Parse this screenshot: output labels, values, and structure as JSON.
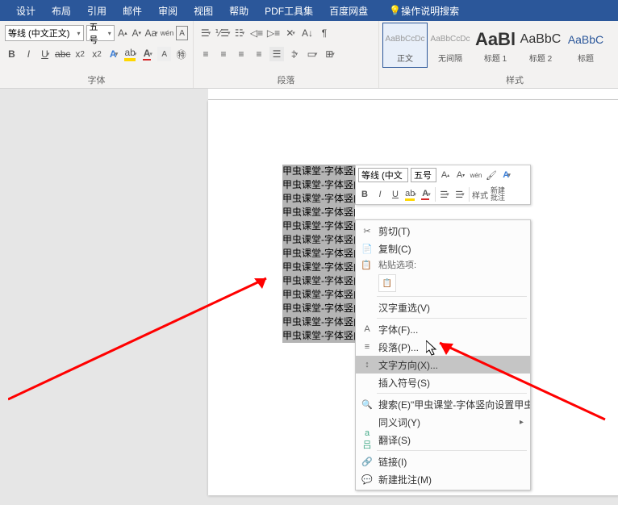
{
  "tabs": [
    "设计",
    "布局",
    "引用",
    "邮件",
    "审阅",
    "视图",
    "帮助",
    "PDF工具集",
    "百度网盘"
  ],
  "tell_me": "操作说明搜索",
  "font_group": {
    "font_name": "等线 (中文正文)",
    "font_size": "五号",
    "label": "字体"
  },
  "para_group": {
    "label": "段落"
  },
  "styles_group": {
    "label": "样式"
  },
  "styles": [
    {
      "sample": "AaBbCcDc",
      "name": "正文"
    },
    {
      "sample": "AaBbCcDc",
      "name": "无间隔"
    },
    {
      "sample": "AaBl",
      "name": "标题 1"
    },
    {
      "sample": "AaBbC",
      "name": "标题 2"
    },
    {
      "sample": "AaBbC",
      "name": "标题"
    }
  ],
  "doc_lines": [
    "甲虫课堂-字体竖向设置",
    "甲虫课堂-字体竖向",
    "甲虫课堂-字体竖向",
    "甲虫课堂-字体竖向设置",
    "甲虫课堂-字体竖向",
    "甲虫课堂-字体竖向",
    "甲虫课堂-字体竖向",
    "甲虫课堂-字体竖向",
    "甲虫课堂-字体竖向",
    "甲虫课堂-字体竖向",
    "甲虫课堂-字体竖向",
    "甲虫课堂-字体竖向",
    "甲虫课堂-字体竖向"
  ],
  "mini": {
    "font_name": "等线 (中文",
    "font_size": "五号",
    "style_btn": "样式",
    "new_comment": "新建\n批注"
  },
  "context_menu": {
    "cut": "剪切(T)",
    "copy": "复制(C)",
    "paste_options": "粘贴选项:",
    "hanzi": "汉字重选(V)",
    "font": "字体(F)...",
    "paragraph": "段落(P)...",
    "text_direction": "文字方向(X)...",
    "insert_symbol": "插入符号(S)",
    "search": "搜索(E)\"甲虫课堂-字体竖向设置甲虫课...",
    "synonym": "同义词(Y)",
    "translate": "翻译(S)",
    "link": "链接(I)",
    "new_comment": "新建批注(M)"
  }
}
